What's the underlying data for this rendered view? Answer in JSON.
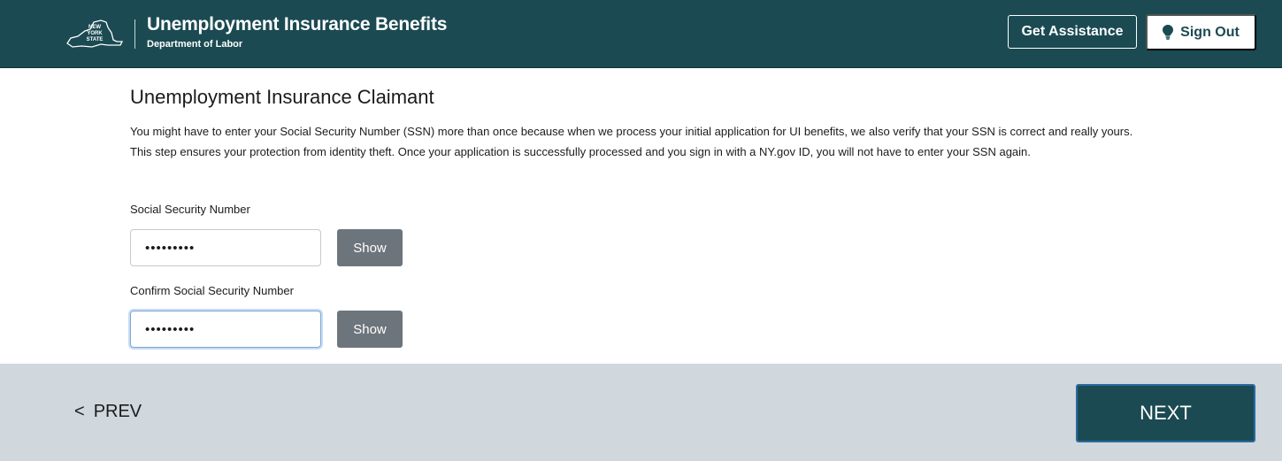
{
  "header": {
    "logo_text": "NEW YORK STATE",
    "title": "Unemployment Insurance Benefits",
    "subtitle": "Department of Labor",
    "get_assistance_label": "Get Assistance",
    "sign_out_label": "Sign Out"
  },
  "main": {
    "title": "Unemployment Insurance Claimant",
    "intro": "You might have to enter your Social Security Number (SSN) more than once because when we process your initial application for UI benefits, we also verify that your SSN is correct and really yours. This step ensures your protection from identity theft. Once your application is successfully processed and you sign in with a NY.gov ID, you will not have to enter your SSN again.",
    "ssn": {
      "label": "Social Security Number",
      "value": "•••••••••",
      "show_label": "Show"
    },
    "confirm_ssn": {
      "label": "Confirm Social Security Number",
      "value": "•••••••••",
      "show_label": "Show"
    }
  },
  "footer": {
    "prev_icon": "<",
    "prev_label": "PREV",
    "next_label": "NEXT"
  },
  "colors": {
    "brand": "#1b4a52",
    "show_button": "#6d757c",
    "footer_bg": "#d0d7dd",
    "focus_ring": "#c7dcf4"
  },
  "icons": {
    "logo": "new-york-state-logo-icon",
    "sign_out": "lightbulb-icon",
    "prev": "chevron-left-icon"
  }
}
